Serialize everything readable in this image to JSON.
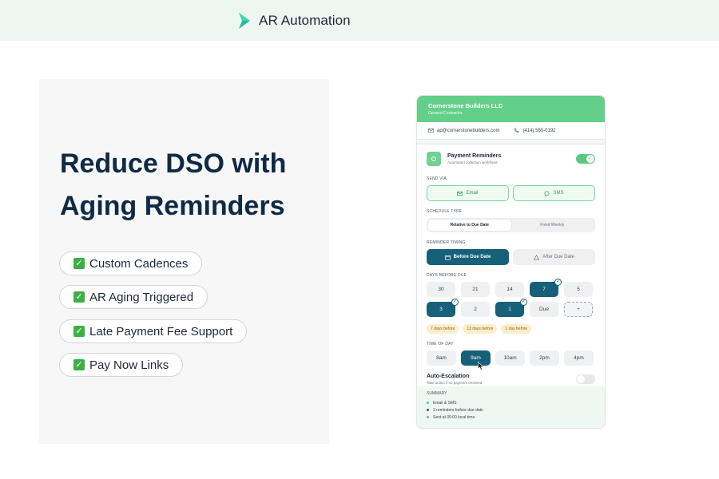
{
  "brand": {
    "name": "AR Automation",
    "accent": "#2bb8a0"
  },
  "hero": {
    "title": "Reduce DSO with Aging Reminders",
    "features": [
      {
        "label": "Custom Cadences"
      },
      {
        "label": "AR Aging Triggered"
      },
      {
        "label": "Late Payment Fee Support"
      },
      {
        "label": "Pay Now Links"
      }
    ]
  },
  "card": {
    "company": "Cornerstone Builders LLC",
    "company_sub": "General Contractor",
    "email": "ap@cornerstonebuilders.com",
    "phone": "(414) 555-0192",
    "reminders": {
      "title": "Payment Reminders",
      "subtitle": "Automated collection workflows",
      "enabled": true
    },
    "send_via": {
      "label": "SEND VIA",
      "options": [
        "Email",
        "SMS"
      ]
    },
    "schedule": {
      "label": "SCHEDULE TYPE",
      "options": [
        "Relative to Due Date",
        "Fixed Weekly"
      ],
      "selected": "Relative to Due Date"
    },
    "timing": {
      "label": "REMINDER TIMING",
      "options": [
        "Before Due Date",
        "After Due Date"
      ],
      "selected": "Before Due Date"
    },
    "days": {
      "label": "DAYS BEFORE DUE",
      "options": [
        "30",
        "21",
        "14",
        "7",
        "5",
        "3",
        "2",
        "1",
        "Due",
        "+"
      ],
      "selected": [
        "7",
        "3",
        "1"
      ]
    },
    "chips": [
      "7 days before",
      "13 days before",
      "1 day before"
    ],
    "time_of_day": {
      "label": "TIME OF DAY",
      "options": [
        "8am",
        "9am",
        "10am",
        "2pm",
        "4pm"
      ],
      "selected": "9am"
    },
    "escalation": {
      "title": "Auto-Escalation",
      "subtitle": "Take action if no payment received",
      "enabled": false
    },
    "summary": {
      "label": "SUMMARY",
      "items": [
        "Email & SMS",
        "3 reminders before due date",
        "Sent at 09:00 local time"
      ]
    }
  },
  "colors": {
    "header_green": "#64cf88",
    "selected_teal": "#17607a",
    "chip_bg": "#fbeecb"
  }
}
